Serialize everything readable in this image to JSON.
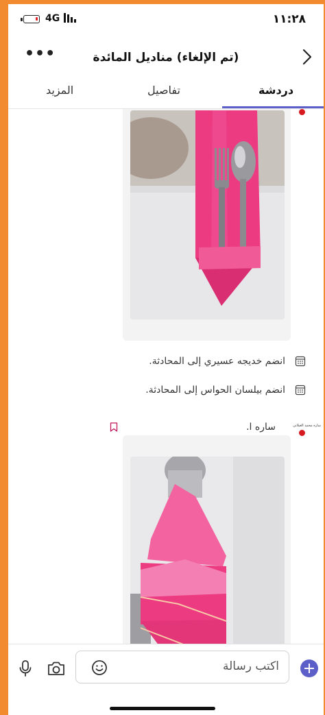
{
  "status_bar": {
    "network": "4G",
    "time": "١١:٢٨",
    "battery_level": 0.12
  },
  "header": {
    "title": "(تم الإلغاء) مناديل المائدة",
    "more_icon": "more-horizontal-icon",
    "back_icon": "chevron-right-icon"
  },
  "tabs": [
    {
      "label": "دردشة",
      "active": true
    },
    {
      "label": "تفاصيل",
      "active": false
    },
    {
      "label": "المزيد",
      "active": false
    }
  ],
  "messages": {
    "system": [
      {
        "text": "انضم خديجه عسيري إلى المحادثة.",
        "icon": "calendar-icon"
      },
      {
        "text": "انضم بيلسان الحواس إلى المحادثة.",
        "icon": "calendar-icon"
      }
    ],
    "second_post": {
      "sender": "ساره ا.",
      "sender_full": "ساره محمد الغيلاني"
    }
  },
  "compose": {
    "placeholder": "اكتب رسالة"
  },
  "colors": {
    "accent": "#5b5fc7",
    "presence": "#d71920",
    "napkin_pink": "#ee3f85",
    "border_orange": "#f28a30"
  }
}
